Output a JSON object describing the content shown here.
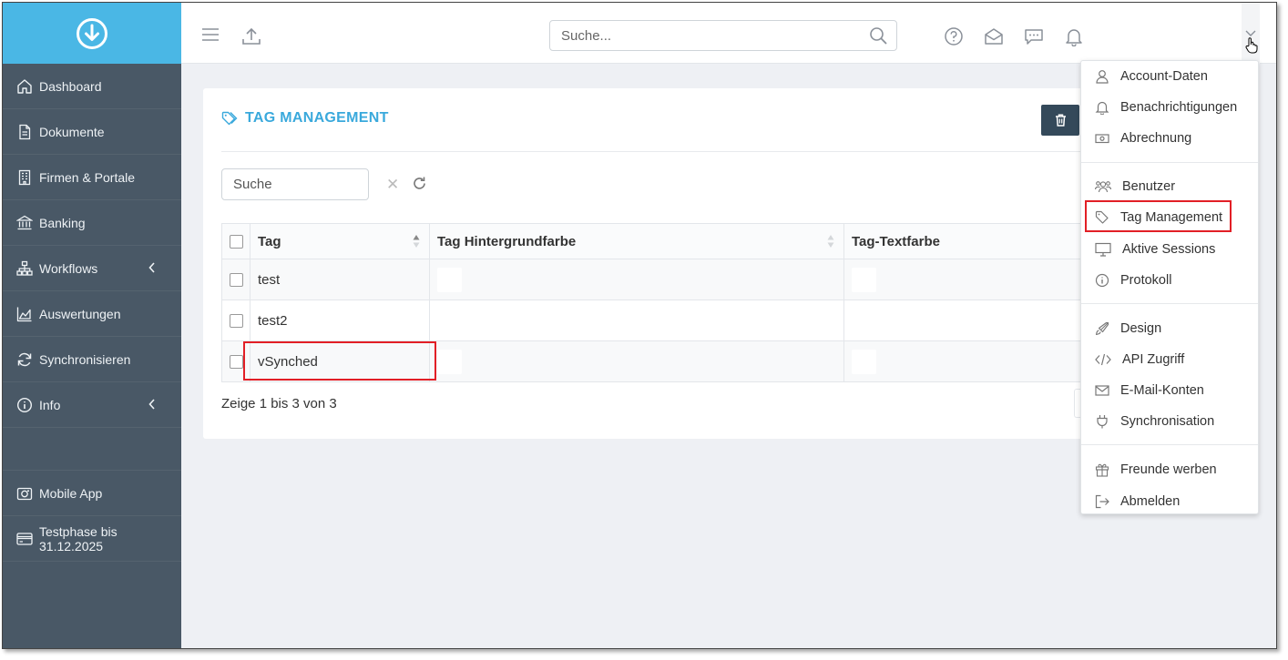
{
  "sidebar": {
    "items": [
      {
        "label": "Dashboard"
      },
      {
        "label": "Dokumente"
      },
      {
        "label": "Firmen & Portale"
      },
      {
        "label": "Banking"
      },
      {
        "label": "Workflows"
      },
      {
        "label": "Auswertungen"
      },
      {
        "label": "Synchronisieren"
      },
      {
        "label": "Info"
      }
    ],
    "bottom": [
      {
        "label": "Mobile App"
      },
      {
        "label": "Testphase bis 31.12.2025"
      }
    ]
  },
  "topbar": {
    "search_placeholder": "Suche..."
  },
  "card": {
    "title": "TAG MANAGEMENT",
    "search_placeholder": "Suche",
    "clear_symbol": "✕",
    "columns": [
      "Tag",
      "Tag Hintergrundfarbe",
      "Tag-Textfarbe"
    ],
    "rows": [
      {
        "tag": "test"
      },
      {
        "tag": "test2"
      },
      {
        "tag": "vSynched"
      }
    ],
    "footer": "Zeige 1 bis 3 von 3"
  },
  "dropdown": {
    "items": [
      {
        "label": "Account-Daten",
        "icon": "user-icon"
      },
      {
        "label": "Benachrichtigungen",
        "icon": "bell-icon"
      },
      {
        "label": "Abrechnung",
        "icon": "money-icon"
      },
      {
        "label": "Benutzer",
        "icon": "users-icon"
      },
      {
        "label": "Tag Management",
        "icon": "tag-icon"
      },
      {
        "label": "Aktive Sessions",
        "icon": "monitor-icon"
      },
      {
        "label": "Protokoll",
        "icon": "info-icon"
      },
      {
        "label": "Design",
        "icon": "brush-icon"
      },
      {
        "label": "API Zugriff",
        "icon": "code-icon"
      },
      {
        "label": "E-Mail-Konten",
        "icon": "mail-icon"
      },
      {
        "label": "Synchronisation",
        "icon": "plug-icon"
      },
      {
        "label": "Freunde werben",
        "icon": "gift-icon"
      },
      {
        "label": "Abmelden",
        "icon": "logout-icon"
      }
    ]
  },
  "colors": {
    "sidebar": "#495866",
    "brand": "#4ab7e5",
    "title": "#3aa9dc",
    "highlight": "#e21f26",
    "button": "#34495a"
  }
}
